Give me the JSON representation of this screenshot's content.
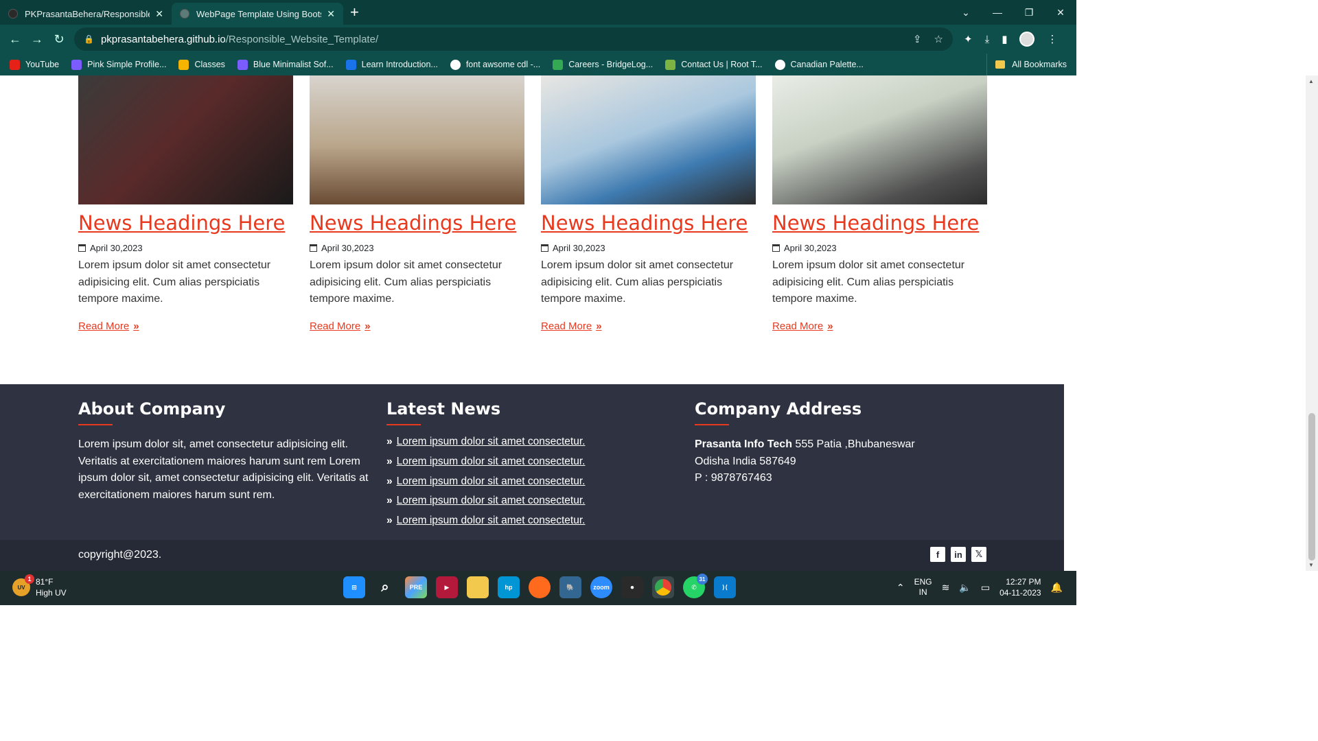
{
  "browser": {
    "tabs": [
      {
        "title": "PKPrasantaBehera/Responsible_\\",
        "active": false
      },
      {
        "title": "WebPage Template Using Bootst",
        "active": true
      }
    ],
    "url_host": "pkprasantabehera.github.io",
    "url_path": "/Responsible_Website_Template/",
    "bookmarks": [
      {
        "label": "YouTube",
        "color": "#e62117"
      },
      {
        "label": "Pink Simple Profile...",
        "color": "#7b5cff"
      },
      {
        "label": "Classes",
        "color": "#f5b400"
      },
      {
        "label": "Blue Minimalist Sof...",
        "color": "#7b5cff"
      },
      {
        "label": "Learn Introduction...",
        "color": "#1a73e8"
      },
      {
        "label": "font awsome cdl -...",
        "color": "#ffffff"
      },
      {
        "label": "Careers - BridgeLog...",
        "color": "#34a853"
      },
      {
        "label": "Contact Us | Root T...",
        "color": "#7cb342"
      },
      {
        "label": "Canadian Palette...",
        "color": "#ffffff"
      }
    ],
    "all_bookmarks": "All Bookmarks"
  },
  "news": [
    {
      "heading": "News Headings Here",
      "date": "April 30,2023",
      "text": "Lorem ipsum dolor sit amet consectetur adipisicing elit. Cum alias perspiciatis tempore maxime.",
      "read_more": "Read More"
    },
    {
      "heading": "News Headings Here",
      "date": "April 30,2023",
      "text": "Lorem ipsum dolor sit amet consectetur adipisicing elit. Cum alias perspiciatis tempore maxime.",
      "read_more": "Read More"
    },
    {
      "heading": "News Headings Here",
      "date": "April 30,2023",
      "text": "Lorem ipsum dolor sit amet consectetur adipisicing elit. Cum alias perspiciatis tempore maxime.",
      "read_more": "Read More"
    },
    {
      "heading": "News Headings Here",
      "date": "April 30,2023",
      "text": "Lorem ipsum dolor sit amet consectetur adipisicing elit. Cum alias perspiciatis tempore maxime.",
      "read_more": "Read More"
    }
  ],
  "footer": {
    "about_title": "About Company",
    "about_text": "Lorem ipsum dolor sit, amet consectetur adipisicing elit. Veritatis at exercitationem maiores harum sunt rem Lorem ipsum dolor sit, amet consectetur adipisicing elit. Veritatis at exercitationem maiores harum sunt rem.",
    "news_title": "Latest News",
    "news_links": [
      "Lorem ipsum dolor sit amet consectetur.",
      "Lorem ipsum dolor sit amet consectetur.",
      "Lorem ipsum dolor sit amet consectetur.",
      "Lorem ipsum dolor sit amet consectetur.",
      "Lorem ipsum dolor sit amet consectetur."
    ],
    "address_title": "Company Address",
    "company_name": "Prasanta Info Tech",
    "address_line1": " 555 Patia ,Bhubaneswar",
    "address_line2": "Odisha India 587649",
    "phone": "P : 9878767463",
    "copyright": "copyright@2023."
  },
  "taskbar": {
    "temp": "81°F",
    "weather": "High UV",
    "lang1": "ENG",
    "lang2": "IN",
    "time": "12:27 PM",
    "date": "04-11-2023",
    "whatsapp_badge": "31",
    "weather_badge": "1"
  }
}
